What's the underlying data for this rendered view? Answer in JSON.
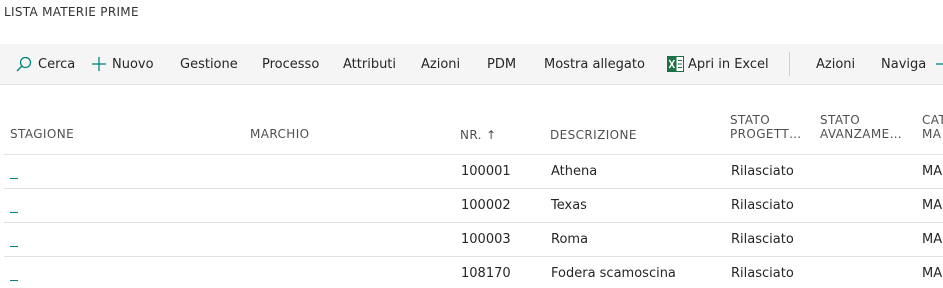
{
  "page": {
    "title": "LISTA MATERIE PRIME"
  },
  "toolbar": {
    "search": "Cerca",
    "new": "Nuovo",
    "manage": "Gestione",
    "process": "Processo",
    "attributes": "Attributi",
    "actions": "Azioni",
    "pdm": "PDM",
    "show_attachment": "Mostra allegato",
    "open_excel": "Apri in Excel",
    "actions2": "Azioni",
    "navigate": "Naviga"
  },
  "colors": {
    "accent": "#00857c",
    "excel": "#1e7145"
  },
  "table": {
    "headers": {
      "season": "STAGIONE",
      "brand": "MARCHIO",
      "number": "NR. ↑",
      "description": "DESCRIZIONE",
      "project_status_1": "STATO",
      "project_status_2": "PROGETT…",
      "progress_status_1": "STATO",
      "progress_status_2": "AVANZAME…",
      "category_1": "CAT",
      "category_2": "MA"
    },
    "rows": [
      {
        "number": "100001",
        "description": "Athena",
        "status": "Rilasciato",
        "category": "MA"
      },
      {
        "number": "100002",
        "description": "Texas",
        "status": "Rilasciato",
        "category": "MA"
      },
      {
        "number": "100003",
        "description": "Roma",
        "status": "Rilasciato",
        "category": "MA"
      },
      {
        "number": "108170",
        "description": "Fodera scamoscina",
        "status": "Rilasciato",
        "category": "MA"
      }
    ]
  }
}
